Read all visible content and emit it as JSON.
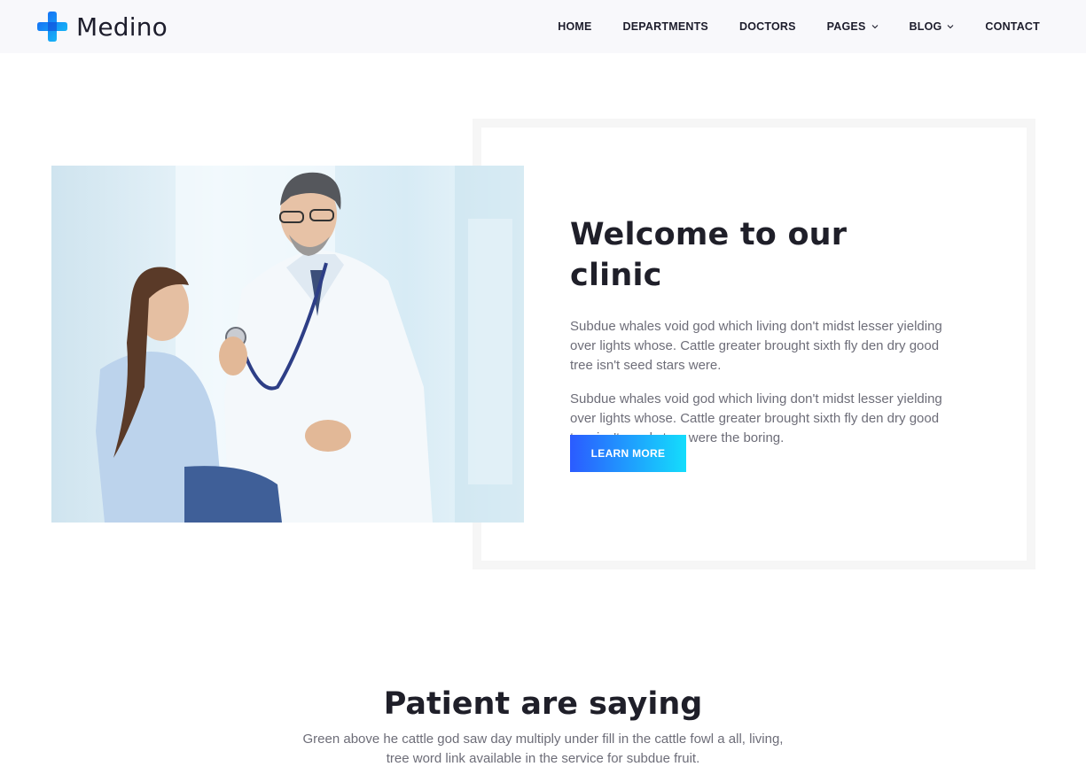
{
  "brand": {
    "name": "Medino",
    "logo_icon": "medical-cross-icon",
    "logo_colors": [
      "#1561f5",
      "#17c6f6"
    ]
  },
  "nav": {
    "items": [
      {
        "label": "HOME",
        "dropdown": false
      },
      {
        "label": "DEPARTMENTS",
        "dropdown": false
      },
      {
        "label": "DOCTORS",
        "dropdown": false
      },
      {
        "label": "PAGES",
        "dropdown": true
      },
      {
        "label": "BLOG",
        "dropdown": true
      },
      {
        "label": "CONTACT",
        "dropdown": false
      }
    ]
  },
  "welcome": {
    "title": "Welcome to our clinic",
    "paragraph1": "Subdue whales void god which living don't midst lesser yielding over lights whose. Cattle greater brought sixth fly den dry good tree isn't seed stars were.",
    "paragraph2": "Subdue whales void god which living don't midst lesser yielding over lights whose. Cattle greater brought sixth fly den dry good tree isn't seed stars were the boring.",
    "button_label": "LEARN MORE",
    "button_gradient": [
      "#2b5bff",
      "#14ddfc"
    ]
  },
  "testimonials": {
    "title": "Patient are saying",
    "subtitle_line1": "Green above he cattle god saw day multiply under fill in the cattle fowl a all, living,",
    "subtitle_line2": "tree word link available in the service for subdue fruit."
  }
}
